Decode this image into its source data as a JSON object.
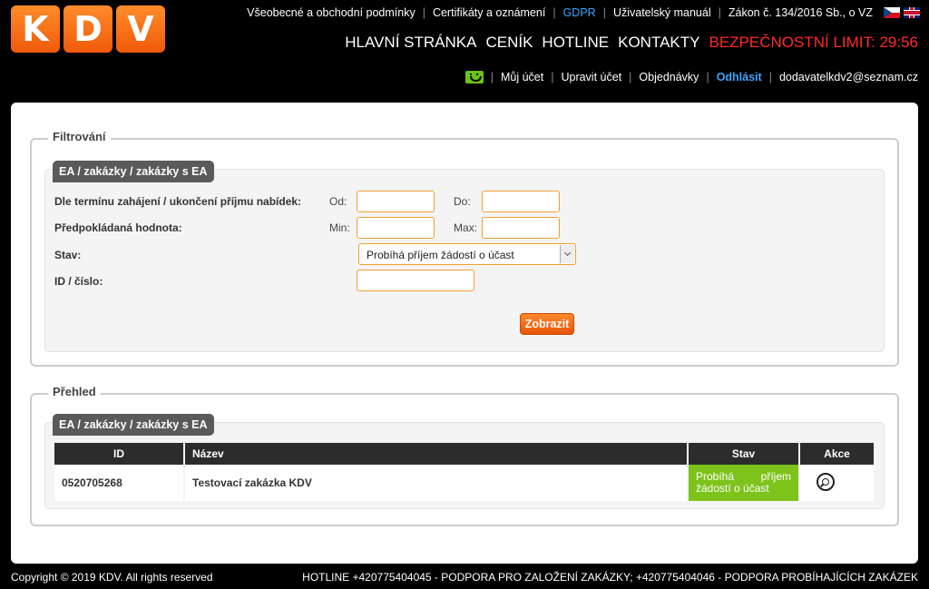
{
  "logo": [
    "K",
    "D",
    "V"
  ],
  "toplinks": {
    "terms": "Všeobecné a obchodní podmínky",
    "certs": "Certifikáty a oznámení",
    "gdpr": "GDPR",
    "manual": "Uživatelský manuál",
    "law": "Zákon č. 134/2016 Sb., o VZ"
  },
  "mainnav": {
    "home": "HLAVNÍ STRÁNKA",
    "pricing": "CENÍK",
    "hotline": "HOTLINE",
    "contacts": "KONTAKTY",
    "limit": "BEZPEČNOSTNÍ LIMIT: 29:56"
  },
  "userbar": {
    "account": "Můj účet",
    "edit": "Upravit účet",
    "orders": "Objednávky",
    "logout": "Odhlásit",
    "email": "dodavatelkdv2@seznam.cz"
  },
  "filter": {
    "legend": "Filtrování",
    "tag": "EA / zakázky / zakázky s EA",
    "date_label": "Dle termínu zahájení / ukončení příjmu nabídek:",
    "from": "Od:",
    "to": "Do:",
    "value_label": "Předpokládaná hodnota:",
    "min": "Min:",
    "max": "Max:",
    "status_label": "Stav:",
    "status_value": "Probíhá příjem žádostí o účast",
    "id_label": "ID / číslo:",
    "submit": "Zobrazit"
  },
  "overview": {
    "legend": "Přehled",
    "tag": "EA / zakázky / zakázky s EA",
    "columns": [
      "ID",
      "Název",
      "Stav",
      "Akce"
    ],
    "rows": [
      {
        "id": "0520705268",
        "name": "Testovací zakázka KDV",
        "status": "Probíhá příjem žádostí o účast"
      }
    ]
  },
  "footer": {
    "copyright": "Copyright © 2019 KDV. All rights reserved",
    "hotline": "HOTLINE +420775404045 - PODPORA PRO ZALOŽENÍ ZAKÁZKY; +420775404046 - PODPORA PROBÍHAJÍCÍCH ZAKÁZEK"
  }
}
